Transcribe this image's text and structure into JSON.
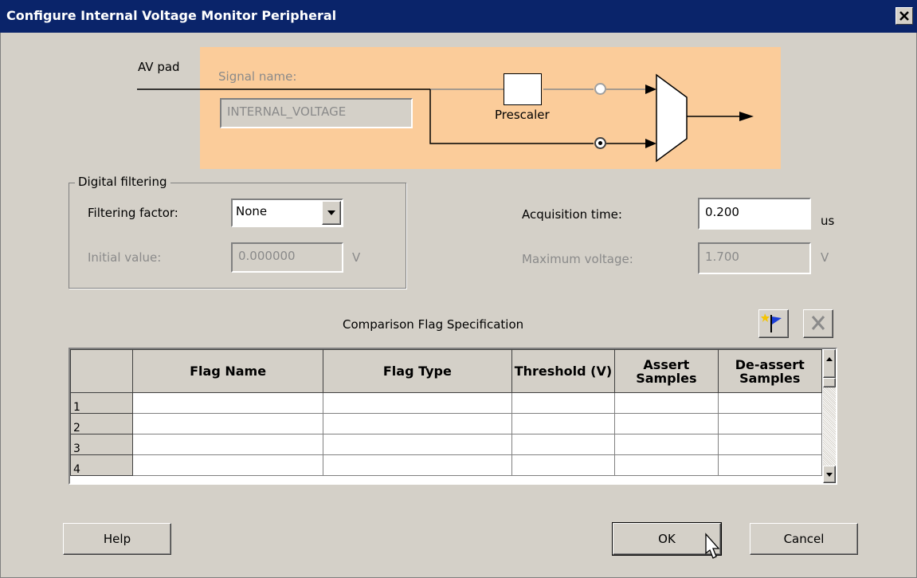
{
  "window": {
    "title": "Configure Internal Voltage Monitor Peripheral",
    "close_glyph": "✕"
  },
  "diagram": {
    "av_pad_label": "AV pad",
    "signal_name_label": "Signal name:",
    "signal_name_value": "INTERNAL_VOLTAGE",
    "prescaler_label": "Prescaler",
    "selected_path": "direct"
  },
  "digital_filtering": {
    "legend": "Digital filtering",
    "filtering_factor_label": "Filtering factor:",
    "filtering_factor_value": "None",
    "initial_value_label": "Initial value:",
    "initial_value": "0.000000",
    "initial_value_unit": "V"
  },
  "acquisition": {
    "time_label": "Acquisition  time:",
    "time_value": "0.200",
    "time_unit": "us",
    "max_voltage_label": "Maximum voltage:",
    "max_voltage_value": "1.700",
    "max_voltage_unit": "V"
  },
  "flags": {
    "title": "Comparison Flag Specification",
    "add_icon": "add-flag-icon",
    "delete_icon": "delete-flag-icon",
    "columns": {
      "name": "Flag Name",
      "type": "Flag Type",
      "threshold": "Threshold (V)",
      "assert": "Assert Samples",
      "deassert": "De-assert Samples"
    },
    "rows": [
      "1",
      "2",
      "3",
      "4"
    ]
  },
  "buttons": {
    "help": "Help",
    "ok": "OK",
    "cancel": "Cancel"
  },
  "colors": {
    "title_bar": "#0a246a",
    "dialog_bg": "#d4d0c8",
    "diagram_bg": "#fbcc9a"
  }
}
